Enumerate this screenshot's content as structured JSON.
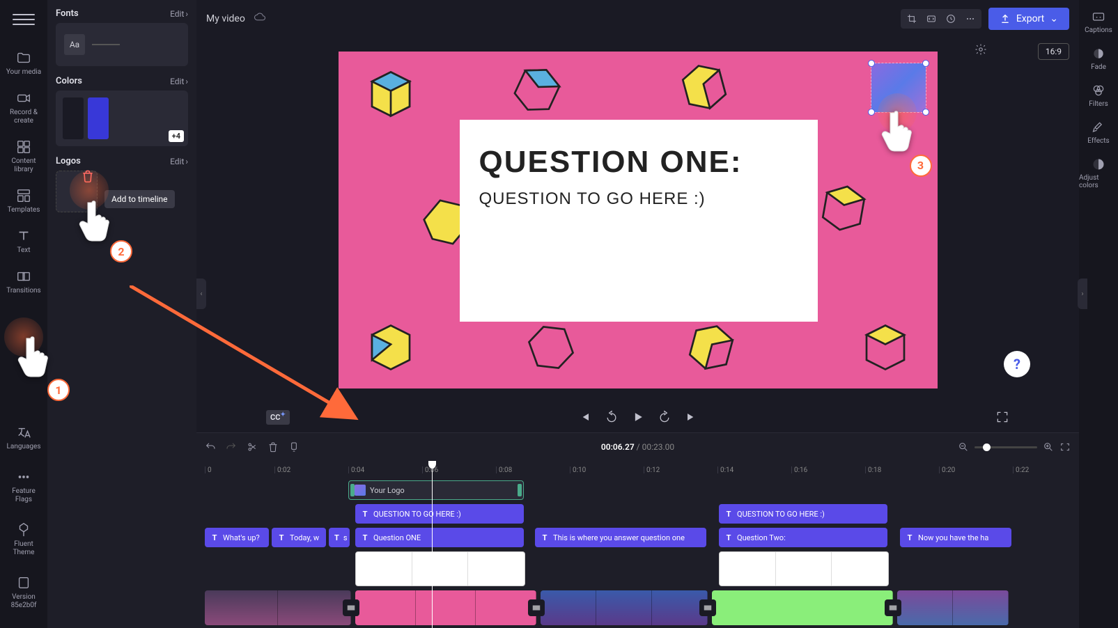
{
  "leftRail": {
    "items": [
      {
        "label": "Your media"
      },
      {
        "label": "Record & create"
      },
      {
        "label": "Content library"
      },
      {
        "label": "Templates"
      },
      {
        "label": "Text"
      },
      {
        "label": "Transitions"
      }
    ],
    "bottom": [
      {
        "label": "Languages"
      },
      {
        "label": "Feature Flags"
      },
      {
        "label": "Fluent Theme"
      },
      {
        "label": "Version 85e2b0f"
      }
    ]
  },
  "sidePanel": {
    "fonts": {
      "title": "Fonts",
      "edit": "Edit",
      "aa": "Aa"
    },
    "colors": {
      "title": "Colors",
      "edit": "Edit",
      "extra": "+4",
      "swatches": [
        "#1a1a24",
        "#3838d8"
      ]
    },
    "logos": {
      "title": "Logos",
      "edit": "Edit"
    }
  },
  "topBar": {
    "projectTitle": "My video",
    "export": "Export",
    "aspect": "16:9"
  },
  "canvas": {
    "heading": "QUESTION ONE:",
    "subheading": "QUESTION TO GO HERE :)"
  },
  "player": {
    "cc": "CC"
  },
  "timeline": {
    "current": "00:06.27",
    "total": "00:23.00",
    "separator": " / ",
    "ticks": [
      "0",
      "0:02",
      "0:04",
      "0:06",
      "0:08",
      "0:10",
      "0:12",
      "0:14",
      "0:16",
      "0:18",
      "0:20",
      "0:22"
    ],
    "clips": {
      "logo": "Your Logo",
      "q1a": "QUESTION TO GO HERE :)",
      "q1b": "QUESTION TO GO HERE :)",
      "t1": "What's up?",
      "t2": "Today, w",
      "t3": "s",
      "t4": "Question ONE",
      "t5": "This is where you answer question one",
      "t6": "Question Two:",
      "t7": "Now you have the ha"
    }
  },
  "rightRail": {
    "items": [
      {
        "label": "Captions"
      },
      {
        "label": "Fade"
      },
      {
        "label": "Filters"
      },
      {
        "label": "Effects"
      },
      {
        "label": "Adjust colors"
      }
    ]
  },
  "tutorial": {
    "step1": "1",
    "step2": "2",
    "step3": "3",
    "tooltip": "Add to timeline"
  },
  "help": "?"
}
